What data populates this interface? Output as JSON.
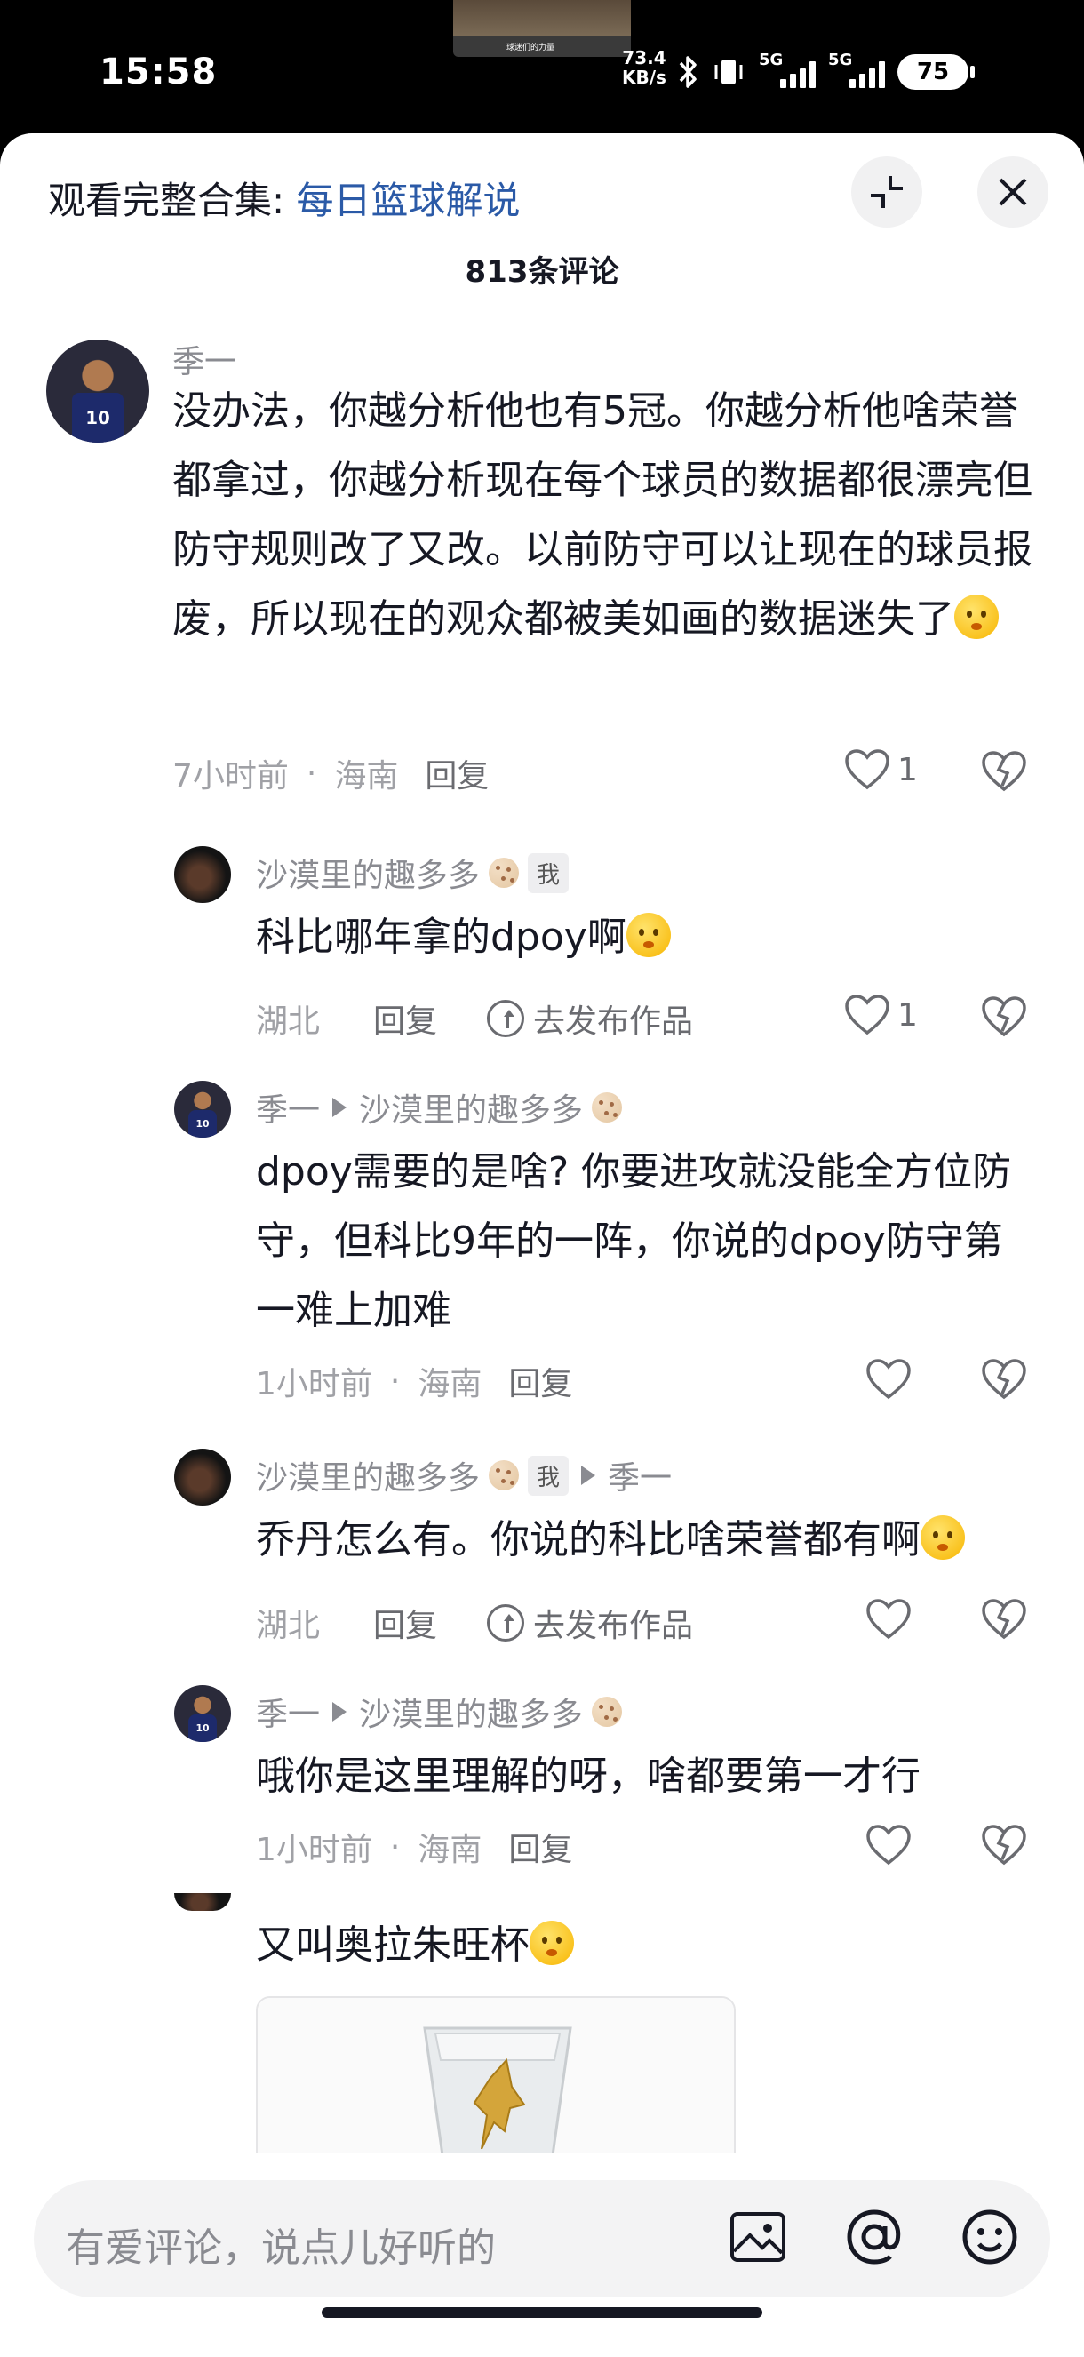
{
  "status_bar": {
    "time": "15:58",
    "net_speed_value": "73.4",
    "net_speed_unit": "KB/s",
    "signal1": "5G",
    "signal2": "5G",
    "battery": "75",
    "video_caption": "球迷们的力量"
  },
  "header": {
    "prefix": "观看完整合集: ",
    "collection": "每日篮球解说",
    "comment_count": "813条评论"
  },
  "comments": [
    {
      "user": "季一",
      "text": "没办法，你越分析他也有5冠。你越分析他啥荣誉都拿过，你越分析现在每个球员的数据都很漂亮但防守规则改了又改。以前防守可以让现在的球员报废，所以现在的观众都被美如画的数据迷失了",
      "time": "7小时前",
      "location": "海南",
      "reply_label": "回复",
      "likes": "1"
    },
    {
      "user": "沙漠里的趣多多",
      "tag": "我",
      "text": "科比哪年拿的dpoy啊",
      "location": "湖北",
      "reply_label": "回复",
      "publish_label": "去发布作品",
      "likes": "1"
    },
    {
      "user": "季一",
      "reply_to": "沙漠里的趣多多",
      "text": "dpoy需要的是啥? 你要进攻就没能全方位防守，但科比9年的一阵，你说的dpoy防守第一难上加难",
      "time": "1小时前",
      "location": "海南",
      "reply_label": "回复"
    },
    {
      "user": "沙漠里的趣多多",
      "tag": "我",
      "reply_to": "季一",
      "text": "乔丹怎么有。你说的科比啥荣誉都有啊",
      "location": "湖北",
      "reply_label": "回复",
      "publish_label": "去发布作品"
    },
    {
      "user": "季一",
      "reply_to": "沙漠里的趣多多",
      "text": "哦你是这里理解的呀，啥都要第一才行",
      "time": "1小时前",
      "location": "海南",
      "reply_label": "回复"
    },
    {
      "text": "又叫奥拉朱旺杯"
    }
  ],
  "input": {
    "placeholder": "有爱评论，说点儿好听的"
  },
  "avatar_number": "10"
}
